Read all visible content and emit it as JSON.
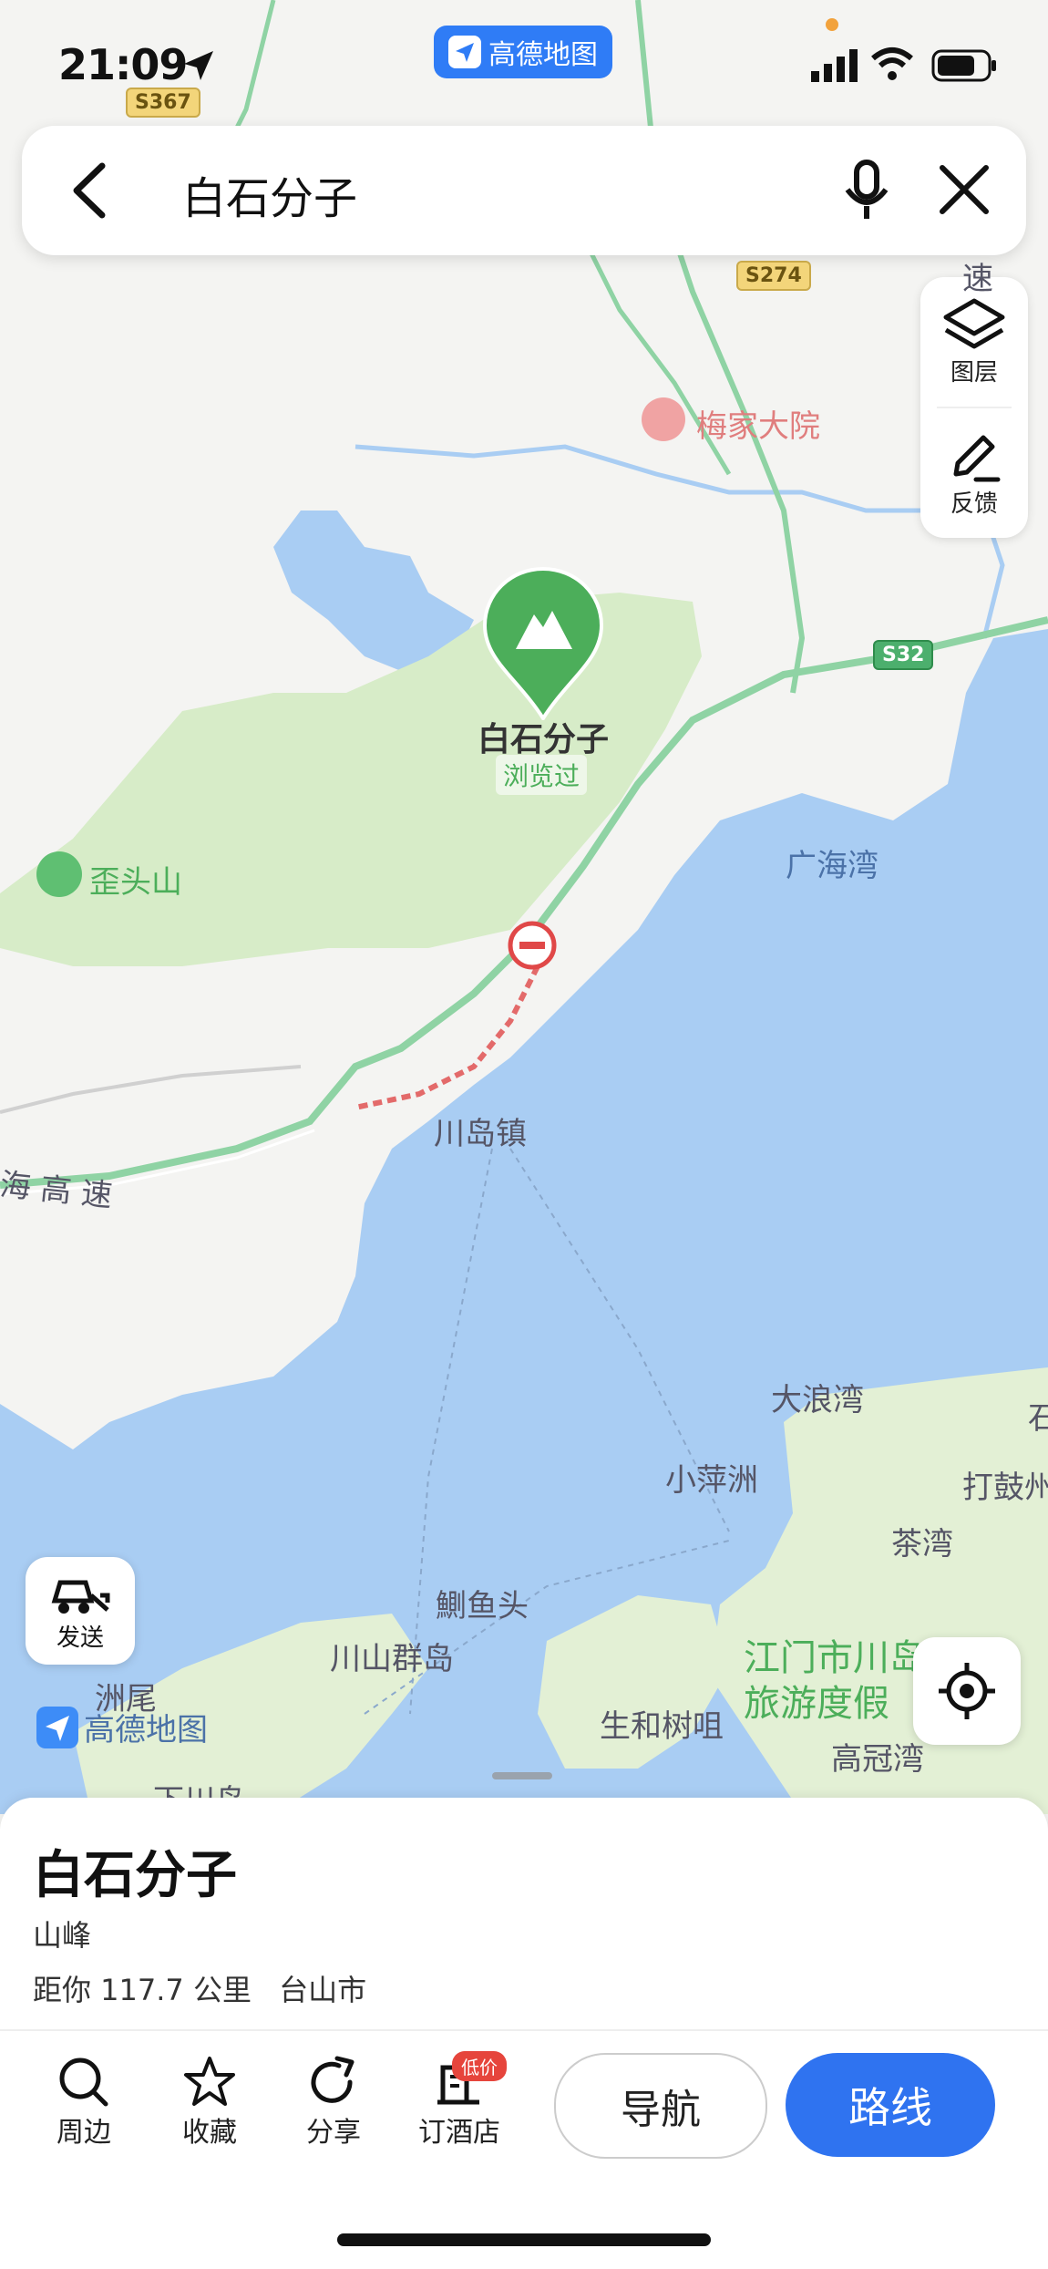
{
  "status_bar": {
    "time": "21:09",
    "app_name": "高德地图"
  },
  "search": {
    "query": "白石分子"
  },
  "tools": {
    "layers_label": "图层",
    "feedback_label": "反馈"
  },
  "map": {
    "roads": [
      "S367",
      "S274",
      "S32"
    ],
    "labels": {
      "meijia": "梅家大院",
      "guanghai": "广海湾",
      "waitou": "歪头山",
      "chuandao": "川岛镇",
      "haigaosu": "海 高 速",
      "dalang": "大浪湾",
      "xiaoping": "小萍洲",
      "dagu": "打鼓州",
      "chawan": "茶湾",
      "diaoyu": "鰂鱼头",
      "chuanshan": "川山群岛",
      "zhouwei": "洲尾",
      "shenghe": "生和树咀",
      "jiangmen1": "江门市川岛",
      "jiangmen2": "旅游度假",
      "gaoguan": "高冠湾",
      "edge_shi": "石",
      "suo": "速",
      "xiachuan": "下川岛"
    },
    "pin": {
      "name": "白石分子",
      "tag": "浏览过"
    },
    "watermark": "高德地图"
  },
  "send_label": "发送",
  "place": {
    "title": "白石分子",
    "type": "山峰",
    "distance": "距你 117.7 公里",
    "city": "台山市"
  },
  "actions": {
    "nearby": "周边",
    "favorite": "收藏",
    "share": "分享",
    "hotel": "订酒店",
    "hotel_badge": "低价"
  },
  "nav_label": "导航",
  "route_label": "路线",
  "colors": {
    "accent": "#2f73f0",
    "water": "#a9cdf3",
    "park": "#d7ecc8",
    "pin": "#4cae5a"
  }
}
